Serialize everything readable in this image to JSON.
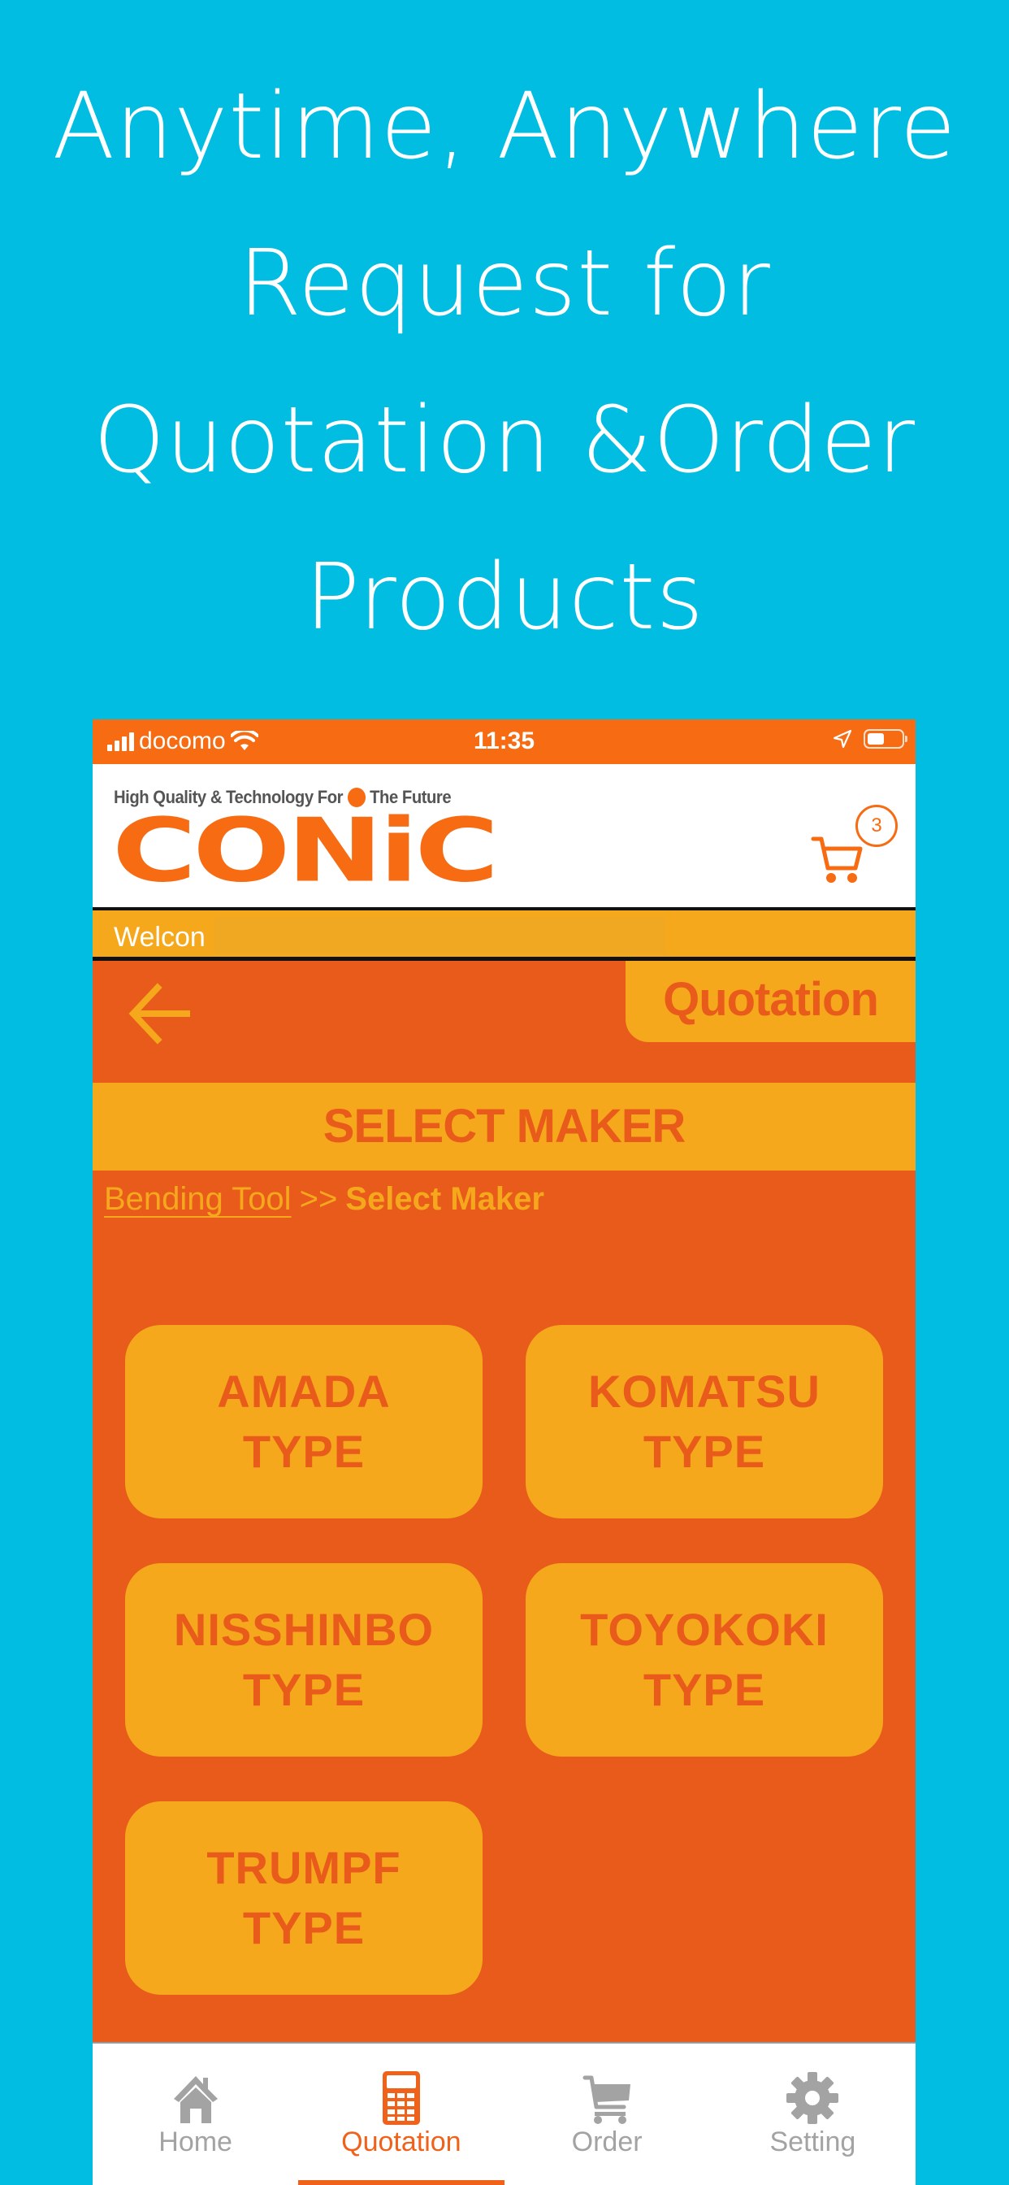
{
  "headline": {
    "lines": [
      "Anytime, Anywhere",
      "Request for",
      "Quotation &Order",
      "Products"
    ]
  },
  "status_bar": {
    "carrier": "docomo",
    "time": "11:35",
    "signal_bars": 4,
    "battery_level": 0.4
  },
  "header": {
    "tagline_left": "High Quality & Technology For",
    "tagline_right": "The Future",
    "logo_text": "CONiC",
    "cart_count": "3"
  },
  "welcome": {
    "text": "Welcon"
  },
  "navbar": {
    "title": "Quotation"
  },
  "section": {
    "title": "SELECT MAKER"
  },
  "breadcrumb": {
    "link": "Bending Tool",
    "separator": ">>",
    "current": "Select Maker"
  },
  "makers": [
    {
      "line1": "AMADA",
      "line2": "TYPE"
    },
    {
      "line1": "KOMATSU",
      "line2": "TYPE"
    },
    {
      "line1": "NISSHINBO",
      "line2": "TYPE"
    },
    {
      "line1": "TOYOKOKI",
      "line2": "TYPE"
    },
    {
      "line1": "TRUMPF",
      "line2": "TYPE"
    }
  ],
  "tabbar": {
    "items": [
      {
        "label": "Home",
        "icon": "home-icon",
        "active": false
      },
      {
        "label": "Quotation",
        "icon": "calculator-icon",
        "active": true
      },
      {
        "label": "Order",
        "icon": "cart-icon",
        "active": false
      },
      {
        "label": "Setting",
        "icon": "gear-icon",
        "active": false
      }
    ]
  },
  "colors": {
    "background": "#00BDE1",
    "brand_orange": "#F76B13",
    "page_orange": "#E95B1B",
    "accent_yellow": "#F5A81C",
    "inactive_gray": "#A3A3A3"
  }
}
